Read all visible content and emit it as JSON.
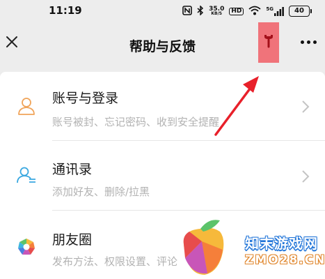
{
  "status_bar": {
    "time": "11:19",
    "nfc_icon": "nfc-icon",
    "bluetooth_icon": "bluetooth-icon",
    "net_speed_value": "35.0",
    "net_speed_unit": "KB/S",
    "hd_label": "HD",
    "wifi_icon": "wifi-icon",
    "signal_label": "5G",
    "battery_level": "40"
  },
  "nav": {
    "title": "帮助与反馈",
    "close_icon": "close-icon",
    "wrench_icon": "wrench-icon",
    "more_icon": "more-dots-icon",
    "highlight_color": "#f0737a"
  },
  "items": [
    {
      "title": "账号与登录",
      "subtitle": "账号被封、忘记密码、收到安全提醒",
      "icon": "account-icon"
    },
    {
      "title": "通讯录",
      "subtitle": "添加好友、删除/拉黑",
      "icon": "contacts-icon"
    },
    {
      "title": "朋友圈",
      "subtitle": "发布方法、权限设置、评论",
      "icon": "moments-icon"
    }
  ],
  "watermark": {
    "name": "知末游戏网",
    "domain": "ZMO28.CN"
  },
  "colors": {
    "background": "#ededed",
    "card": "#ffffff",
    "annotation_red": "#e8202a",
    "icon_orange": "#f0a45a",
    "icon_blue": "#3aa8e0"
  }
}
